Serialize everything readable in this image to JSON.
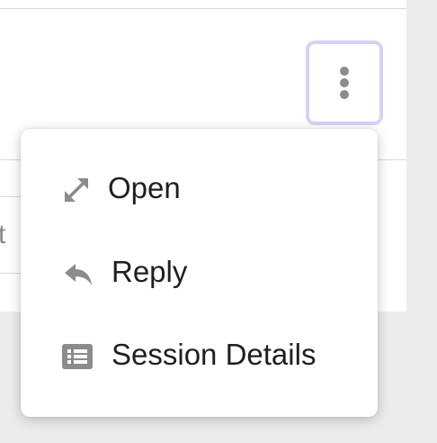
{
  "row": {
    "truncated_text": "t"
  },
  "more_button": {
    "icon": "more-vertical-icon"
  },
  "menu": {
    "items": [
      {
        "label": "Open",
        "icon": "expand-icon"
      },
      {
        "label": "Reply",
        "icon": "reply-icon"
      },
      {
        "label": "Session Details",
        "icon": "list-details-icon"
      }
    ]
  },
  "colors": {
    "icon_gray": "#8c8c8c",
    "focus_ring": "#d6d1fb",
    "text": "#1f1f1f"
  }
}
